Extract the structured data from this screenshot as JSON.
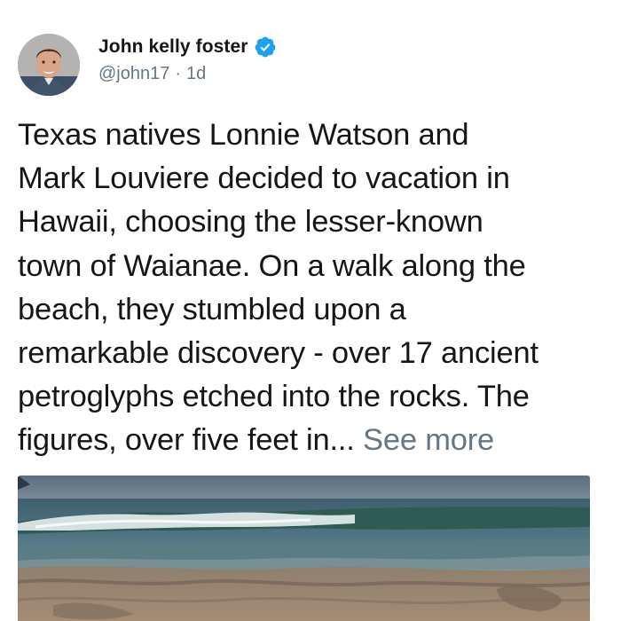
{
  "tweet": {
    "author": {
      "display_name": "John kelly foster",
      "handle": "@john17",
      "verified": true,
      "avatar_icon": "profile-photo"
    },
    "time_separator": "·",
    "timestamp": "1d",
    "text": "Texas natives Lonnie Watson and\nMark Louviere decided to vacation in\nHawaii, choosing the lesser-known\ntown of Waianae. On a walk along the\nbeach, they stumbled upon a\nremarkable discovery - over 17 ancient\npetroglyphs etched into the rocks. The\nfigures, over five feet in...",
    "see_more_label": "See more",
    "media": {
      "icon": "beach-photo"
    }
  },
  "colors": {
    "text": "#14171a",
    "secondary": "#657786",
    "verified_badge": "#1da1f2"
  }
}
